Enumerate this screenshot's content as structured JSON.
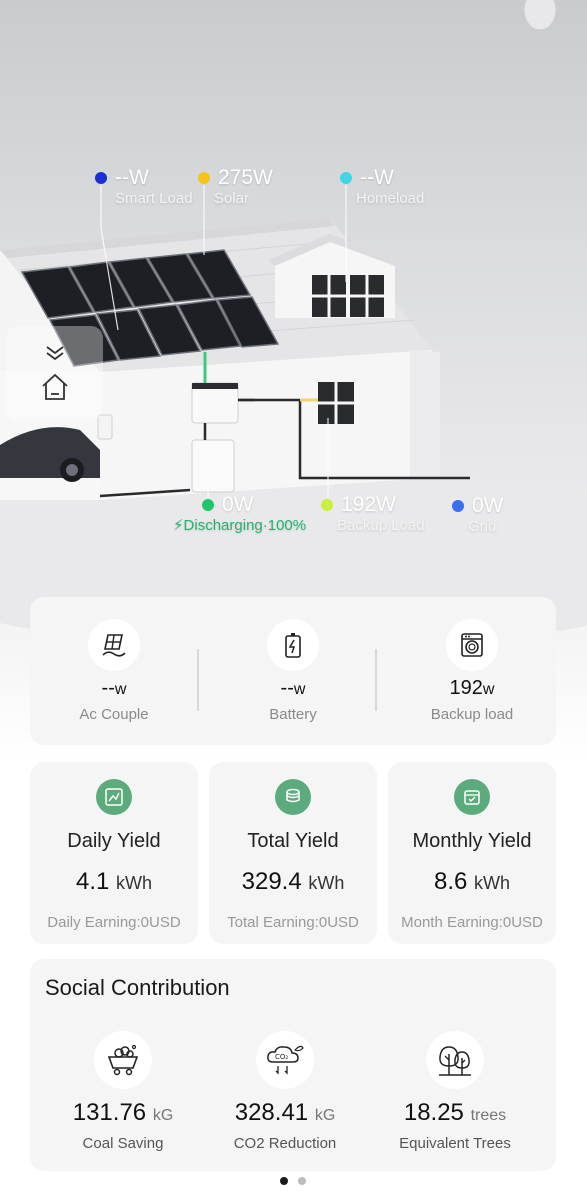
{
  "energy_flow": {
    "smart_load": {
      "value": "--W",
      "label": "Smart Load",
      "color": "#1a2fd6"
    },
    "solar": {
      "value": "275W",
      "label": "Solar",
      "color": "#f5c518"
    },
    "homeload": {
      "value": "--W",
      "label": "Homeload",
      "color": "#3fd6e8"
    },
    "battery": {
      "value": "0W",
      "status": "Discharging·100%",
      "color": "#1ec56a"
    },
    "backup_load": {
      "value": "192W",
      "label": "Backup Load",
      "color": "#c9f03c"
    },
    "grid": {
      "value": "0W",
      "label": "Grid",
      "color": "#3b6ef0"
    }
  },
  "summary": {
    "ac_couple": {
      "value": "--",
      "unit": "w",
      "label": "Ac Couple"
    },
    "battery": {
      "value": "--",
      "unit": "w",
      "label": "Battery"
    },
    "backup_load": {
      "value": "192",
      "unit": "w",
      "label": "Backup load"
    }
  },
  "yield": {
    "daily": {
      "title": "Daily Yield",
      "value": "4.1",
      "unit": "kWh",
      "earning": "Daily Earning:0USD"
    },
    "total": {
      "title": "Total Yield",
      "value": "329.4",
      "unit": "kWh",
      "earning": "Total Earning:0USD"
    },
    "monthly": {
      "title": "Monthly Yield",
      "value": "8.6",
      "unit": "kWh",
      "earning": "Month Earning:0USD"
    }
  },
  "social": {
    "title": "Social Contribution",
    "coal": {
      "value": "131.76",
      "unit": "kG",
      "label": "Coal Saving"
    },
    "co2": {
      "value": "328.41",
      "unit": "kG",
      "label": "CO2 Reduction",
      "icon_text": "CO₂"
    },
    "trees": {
      "value": "18.25",
      "unit": "trees",
      "label": "Equivalent Trees"
    }
  },
  "colors": {
    "accent_green": "#5cab7d",
    "discharge_green": "#22b36b"
  },
  "icons": [
    "chevron-double-down-icon",
    "home-icon",
    "solar-panel-icon",
    "battery-icon",
    "washing-machine-icon",
    "chart-icon",
    "coins-icon",
    "calendar-check-icon",
    "coal-cart-icon",
    "co2-cloud-icon",
    "trees-icon"
  ],
  "pager": {
    "active": 0,
    "count": 2
  }
}
